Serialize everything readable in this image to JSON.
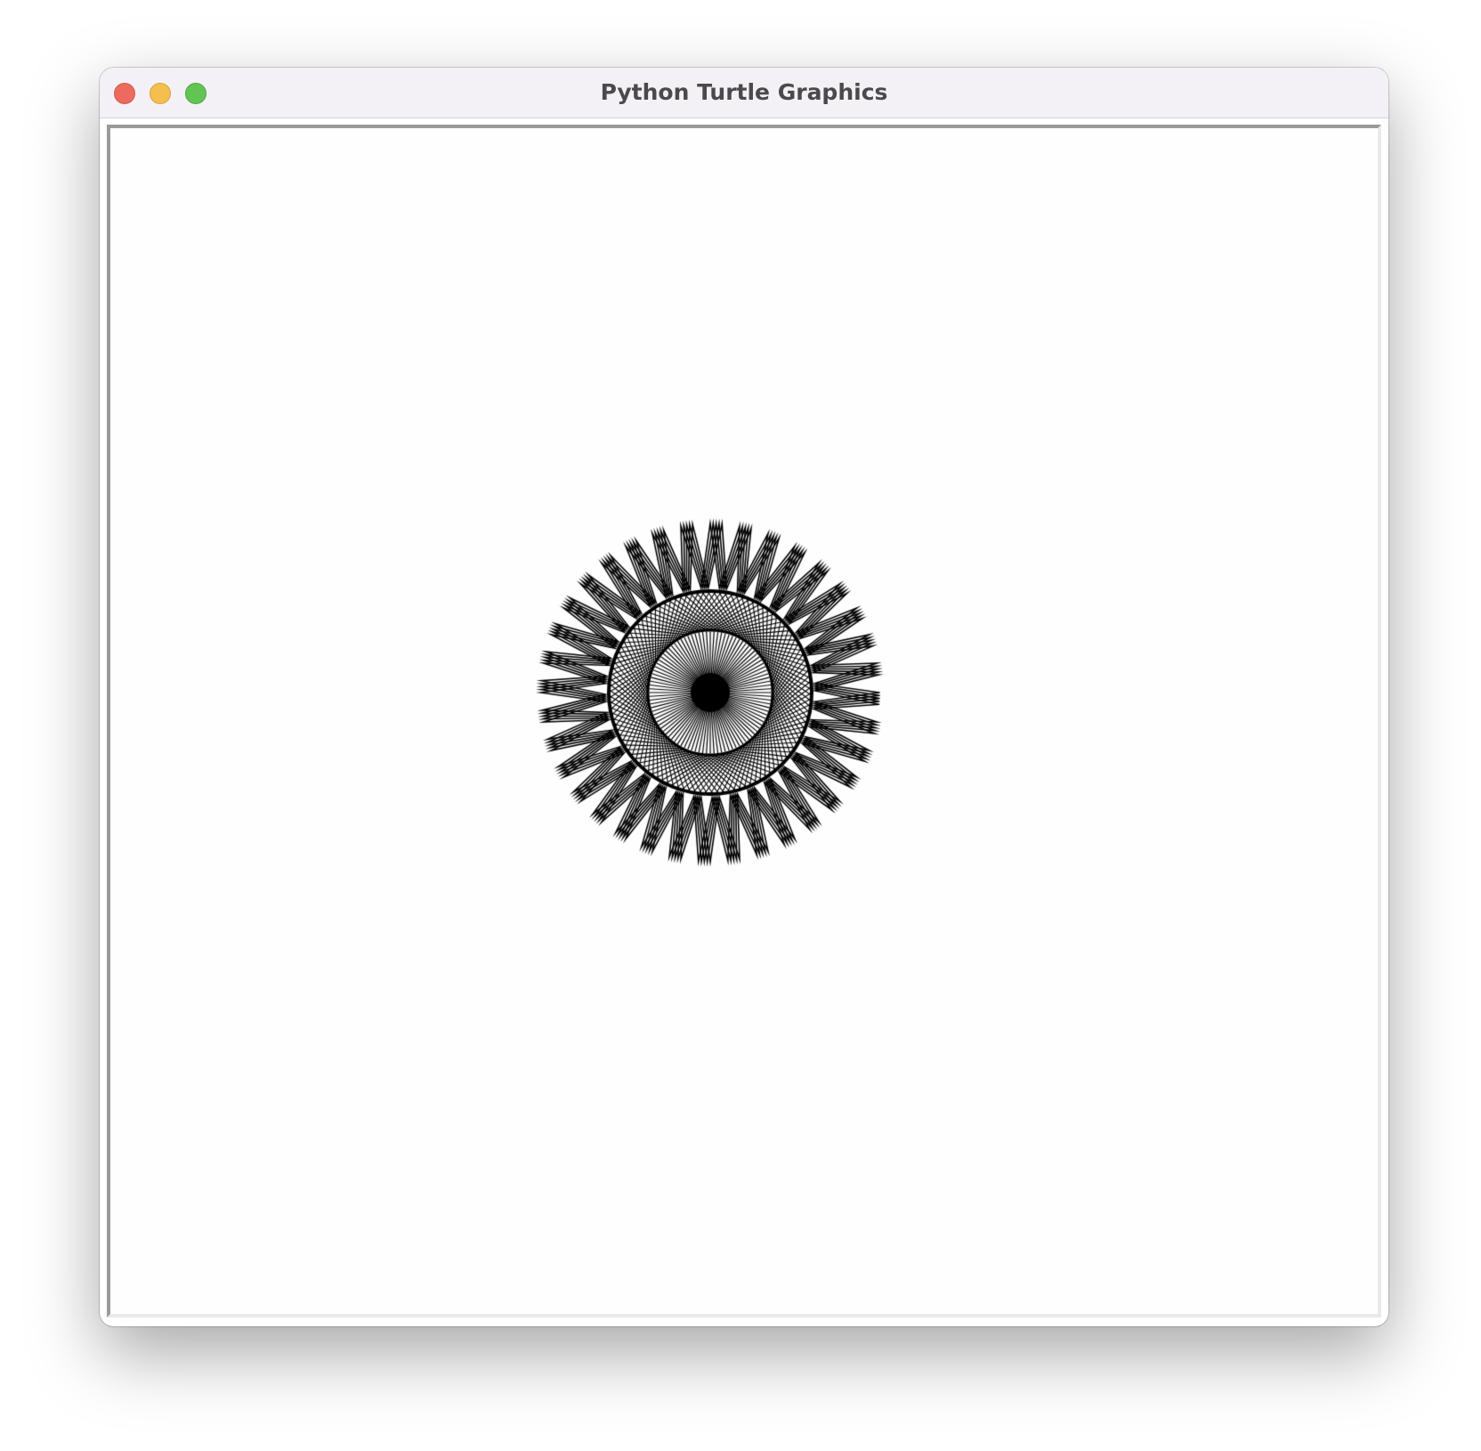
{
  "window": {
    "title": "Python Turtle Graphics"
  },
  "titlebar": {
    "buttons": [
      {
        "name": "close",
        "color": "#ed6a5e"
      },
      {
        "name": "minimize",
        "color": "#f5bf4f"
      },
      {
        "name": "zoom",
        "color": "#61c554"
      }
    ]
  },
  "canvas": {
    "background": "#fefefe",
    "pen_color": "#000000",
    "drawing": "spirograph"
  }
}
